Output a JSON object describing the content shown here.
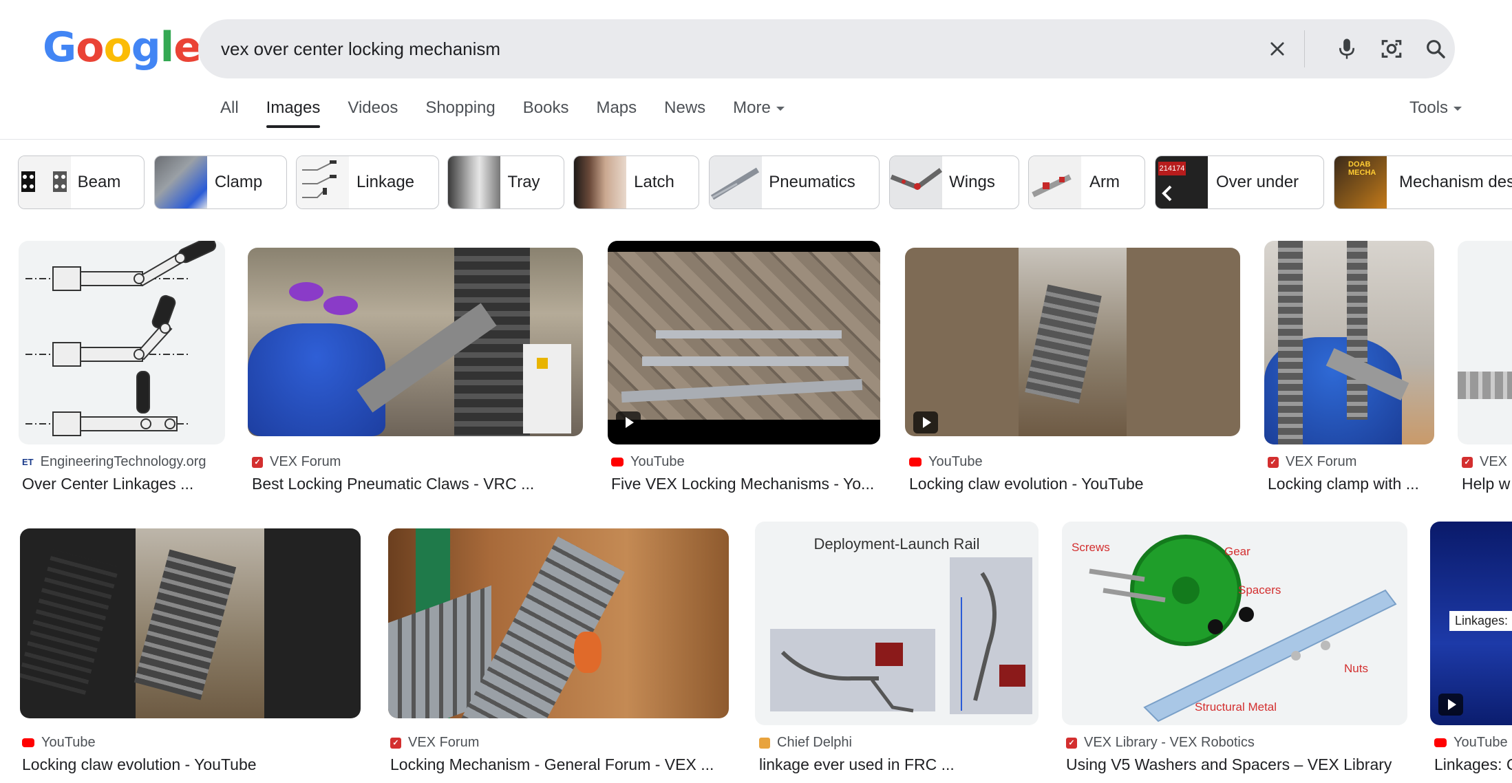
{
  "logo": {
    "letters": [
      "G",
      "o",
      "o",
      "g",
      "l",
      "e"
    ]
  },
  "search": {
    "query": "vex over center locking mechanism"
  },
  "tabs": [
    "All",
    "Images",
    "Videos",
    "Shopping",
    "Books",
    "Maps",
    "News",
    "More"
  ],
  "tools_label": "Tools",
  "chips": [
    "Beam",
    "Clamp",
    "Linkage",
    "Tray",
    "Latch",
    "Pneumatics",
    "Wings",
    "Arm",
    "Over under",
    "Mechanism des"
  ],
  "row1": [
    {
      "source": "EngineeringTechnology.org",
      "title": "Over Center Linkages ...",
      "fav": "ET"
    },
    {
      "source": "VEX Forum",
      "title": "Best Locking Pneumatic Claws - VRC ...",
      "fav": "vex"
    },
    {
      "source": "YouTube",
      "title": "Five VEX Locking Mechanisms - Yo...",
      "fav": "yt"
    },
    {
      "source": "YouTube",
      "title": "Locking claw evolution - YouTube",
      "fav": "yt"
    },
    {
      "source": "VEX Forum",
      "title": "Locking clamp with ...",
      "fav": "vex"
    },
    {
      "source": "VEX F",
      "title": "Help w",
      "fav": "vex"
    }
  ],
  "row2": [
    {
      "source": "YouTube",
      "title": "Locking claw evolution - YouTube",
      "fav": "yt"
    },
    {
      "source": "VEX Forum",
      "title": "Locking Mechanism - General Forum - VEX ...",
      "fav": "vex"
    },
    {
      "source": "Chief Delphi",
      "title": "linkage ever used in FRC ...",
      "fav": "cd"
    },
    {
      "source": "VEX Library - VEX Robotics",
      "title": "Using V5 Washers and Spacers – VEX Library",
      "fav": "vex"
    },
    {
      "source": "YouTube",
      "title": "Linkages: C",
      "fav": "yt"
    }
  ],
  "image_text": {
    "deployment": "Deployment-Launch Rail",
    "screws": "Screws",
    "gear": "Gear",
    "spacers": "Spacers",
    "nuts": "Nuts",
    "structural": "Structural Metal",
    "linkages": "Linkages:",
    "chip_mech": "DOAB MECHA",
    "chip_over": "214174"
  },
  "colors": {
    "blue": "#4285F4",
    "red": "#EA4335",
    "yellow": "#FBBC05",
    "green": "#34A853"
  }
}
